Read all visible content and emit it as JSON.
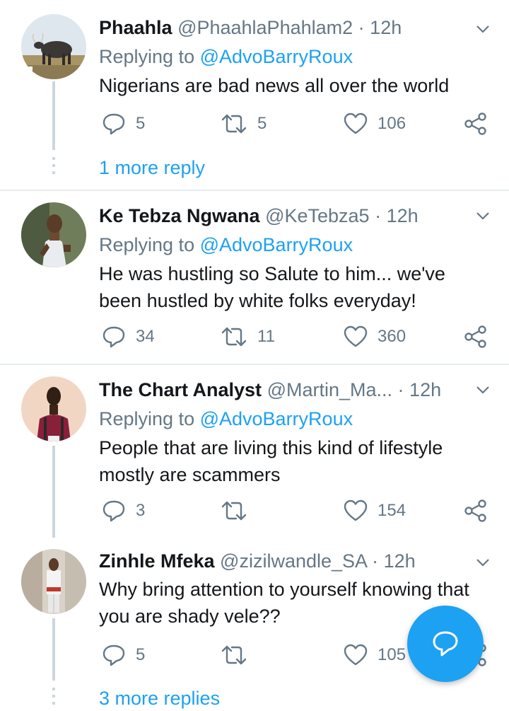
{
  "tweets": [
    {
      "name": "Phaahla",
      "handle": "@PhaahlaPhahlam2",
      "sep": "·",
      "time": "12h",
      "reply_prefix": "Replying to ",
      "reply_handle": "@AdvoBarryRoux",
      "text": [
        "Nigerians are bad news all over the world"
      ],
      "replies": "5",
      "retweets": "5",
      "likes": "106",
      "more": "1 more reply"
    },
    {
      "name": "Ke Tebza Ngwana",
      "handle": "@KeTebza5",
      "sep": "·",
      "time": "12h",
      "reply_prefix": "Replying to ",
      "reply_handle": "@AdvoBarryRoux",
      "text": [
        "He was hustling so Salute to him... we've",
        "been hustled by white folks everyday!"
      ],
      "replies": "34",
      "retweets": "11",
      "likes": "360"
    },
    {
      "name": "The Chart Analyst",
      "handle": "@Martin_Ma...",
      "sep": "·",
      "time": "12h",
      "reply_prefix": "Replying to ",
      "reply_handle": "@AdvoBarryRoux",
      "text": [
        "People that are living this kind of lifestyle",
        "mostly are scammers"
      ],
      "replies": "3",
      "retweets": "",
      "likes": "154"
    },
    {
      "name": "Zinhle Mfeka",
      "handle": "@zizilwandle_SA",
      "sep": "·",
      "time": "12h",
      "text": [
        "Why bring attention to yourself knowing that",
        "you are shady vele??"
      ],
      "replies": "5",
      "retweets": "",
      "likes": "105",
      "more": "3 more replies"
    }
  ],
  "icons": {
    "reply": "reply-icon",
    "retweet": "retweet-icon",
    "like": "heart-icon",
    "share": "share-icon",
    "compose": "compose-reply-icon",
    "chevron": "chevron-down-icon"
  },
  "colors": {
    "accent": "#1da1f2",
    "muted": "#657786",
    "text": "#14171a",
    "divider": "#e6ecf0",
    "thread": "#ccd6dd"
  }
}
